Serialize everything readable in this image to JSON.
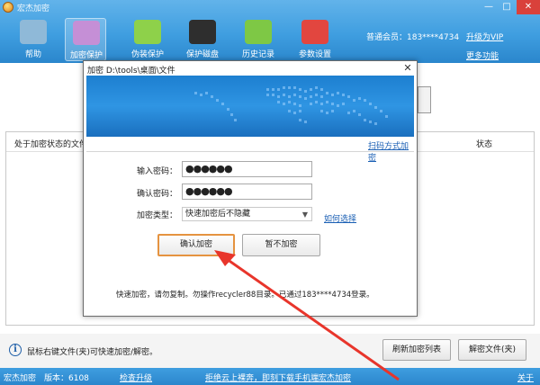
{
  "app": {
    "title": "宏杰加密",
    "window_controls": {
      "minimize": "—",
      "maximize": "□",
      "close": "✕"
    }
  },
  "toolbar": {
    "items": [
      {
        "label": "帮助",
        "icon": "house-shield-icon",
        "color": "#8fb9d8"
      },
      {
        "label": "加密保护",
        "icon": "encrypt-folder-icon",
        "color": "#c58fd6",
        "active": true
      },
      {
        "label": "伪装保护",
        "icon": "disguise-folder-icon",
        "color": "#8ed14a"
      },
      {
        "label": "保护磁盘",
        "icon": "floppy-disk-icon",
        "color": "#2e2e2e"
      },
      {
        "label": "历史记录",
        "icon": "history-icon",
        "color": "#7ec845"
      },
      {
        "label": "参数设置",
        "icon": "toolbox-icon",
        "color": "#e2463f"
      }
    ],
    "member": "普通会员：183****4734",
    "upgrade": "升级为VIP",
    "more": "更多功能"
  },
  "list": {
    "col_files": "处于加密状态的文件",
    "col_status": "状态"
  },
  "status_bar": {
    "hint": "鼠标右键文件(夹)可快速加密/解密。",
    "refresh_button": "刷新加密列表",
    "decrypt_button": "解密文件(夹)"
  },
  "footer": {
    "brand": "宏杰加密",
    "version": "版本：6108",
    "check_update": "检查升级",
    "ad": "拒绝云上裸奔，即刻下载手机端宏杰加密",
    "about": "关于"
  },
  "dialog": {
    "title": "加密 D:\\tools\\桌面\\文件",
    "close": "✕",
    "qr_link": "扫码方式加密",
    "password_label": "输入密码：",
    "password_value": "●●●●●●",
    "confirm_label": "确认密码：",
    "confirm_value": "●●●●●●",
    "type_label": "加密类型：",
    "type_value": "快速加密后不隐藏",
    "howto_link": "如何选择",
    "confirm_button": "确认加密",
    "skip_button": "暂不加密",
    "note": "快速加密，请勿复制。勿操作recycler88目录。已通过183****4734登录。"
  },
  "colors": {
    "header": "#3f9ee0",
    "accent_link": "#1a5fb4",
    "arrow": "#e8352b",
    "focus_border": "#e59340"
  }
}
